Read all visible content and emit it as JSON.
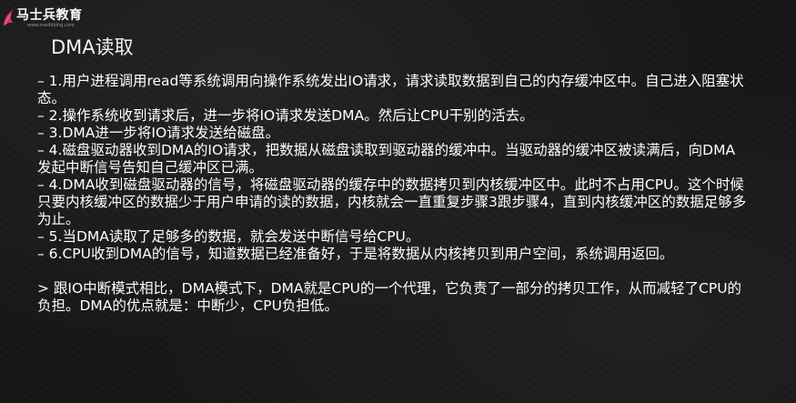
{
  "brand": {
    "name": "马士兵教育",
    "url": "www.mashibing.com",
    "accent": "#d6336c"
  },
  "slide": {
    "title": "DMA读取",
    "bullets": [
      "– 1.用户进程调用read等系统调用向操作系统发出IO请求，请求读取数据到自己的内存缓冲区中。自己进入阻塞状态。",
      "– 2.操作系统收到请求后，进一步将IO请求发送DMA。然后让CPU干别的活去。",
      "– 3.DMA进一步将IO请求发送给磁盘。",
      "– 4.磁盘驱动器收到DMA的IO请求，把数据从磁盘读取到驱动器的缓冲中。当驱动器的缓冲区被读满后，向DMA发起中断信号告知自己缓冲区已满。",
      "– 4.DMA收到磁盘驱动器的信号，将磁盘驱动器的缓存中的数据拷贝到内核缓冲区中。此时不占用CPU。这个时候只要内核缓冲区的数据少于用户申请的读的数据，内核就会一直重复步骤3跟步骤4，直到内核缓冲区的数据足够多为止。",
      "– 5.当DMA读取了足够多的数据，就会发送中断信号给CPU。",
      "– 6.CPU收到DMA的信号，知道数据已经准备好，于是将数据从内核拷贝到用户空间，系统调用返回。"
    ],
    "note": "> 跟IO中断模式相比，DMA模式下，DMA就是CPU的一个代理，它负责了一部分的拷贝工作，从而减轻了CPU的负担。DMA的优点就是：中断少，CPU负担低。"
  }
}
